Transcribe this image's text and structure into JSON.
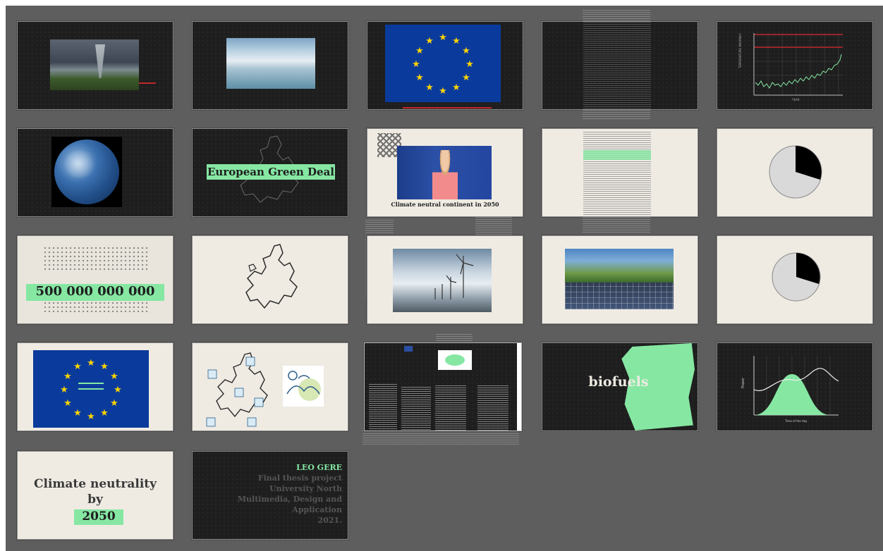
{
  "colors": {
    "workspace": "#5e5e5e",
    "dark_slide": "#1e1e1e",
    "cream_slide": "#efebe3",
    "green_highlight": "#86e7a3",
    "eu_blue": "#0a3b9c",
    "eu_star": "#ffd400",
    "red_line": "#c0282d"
  },
  "slides": [
    {
      "id": 1,
      "type": "image",
      "image": "tornado-storm-photo"
    },
    {
      "id": 2,
      "type": "image",
      "image": "glacier-photo"
    },
    {
      "id": 3,
      "type": "image",
      "image": "eu-flag"
    },
    {
      "id": 4,
      "type": "text-page"
    },
    {
      "id": 5,
      "type": "chart",
      "image": "temperature-line-chart"
    },
    {
      "id": 6,
      "type": "image",
      "image": "earth-photo"
    },
    {
      "id": 7,
      "type": "title",
      "text": "European Green Deal"
    },
    {
      "id": 8,
      "type": "image-caption",
      "caption": "Climate neutral continent in 2050"
    },
    {
      "id": 9,
      "type": "text-page"
    },
    {
      "id": 10,
      "type": "pie"
    },
    {
      "id": 11,
      "type": "number",
      "text": "500 000 000 000"
    },
    {
      "id": 12,
      "type": "image",
      "image": "europe-outline-map"
    },
    {
      "id": 13,
      "type": "image",
      "image": "wind-turbines-photo"
    },
    {
      "id": 14,
      "type": "image",
      "image": "solar-panels-photo"
    },
    {
      "id": 15,
      "type": "pie"
    },
    {
      "id": 16,
      "type": "image",
      "image": "eu-flag"
    },
    {
      "id": 17,
      "type": "image",
      "image": "europe-icons-map"
    },
    {
      "id": 18,
      "type": "text-page"
    },
    {
      "id": 19,
      "type": "title",
      "text": "biofuels"
    },
    {
      "id": 20,
      "type": "chart",
      "image": "bell-curve-chart"
    },
    {
      "id": 21,
      "type": "title",
      "line1": "Climate neutrality",
      "line2": "by",
      "line3": "2050"
    },
    {
      "id": 22,
      "type": "credits",
      "name": "LEO GERE",
      "lines": [
        "Final thesis project",
        "University North",
        "Multimedia, Design and",
        "Application",
        "2021."
      ]
    }
  ]
}
